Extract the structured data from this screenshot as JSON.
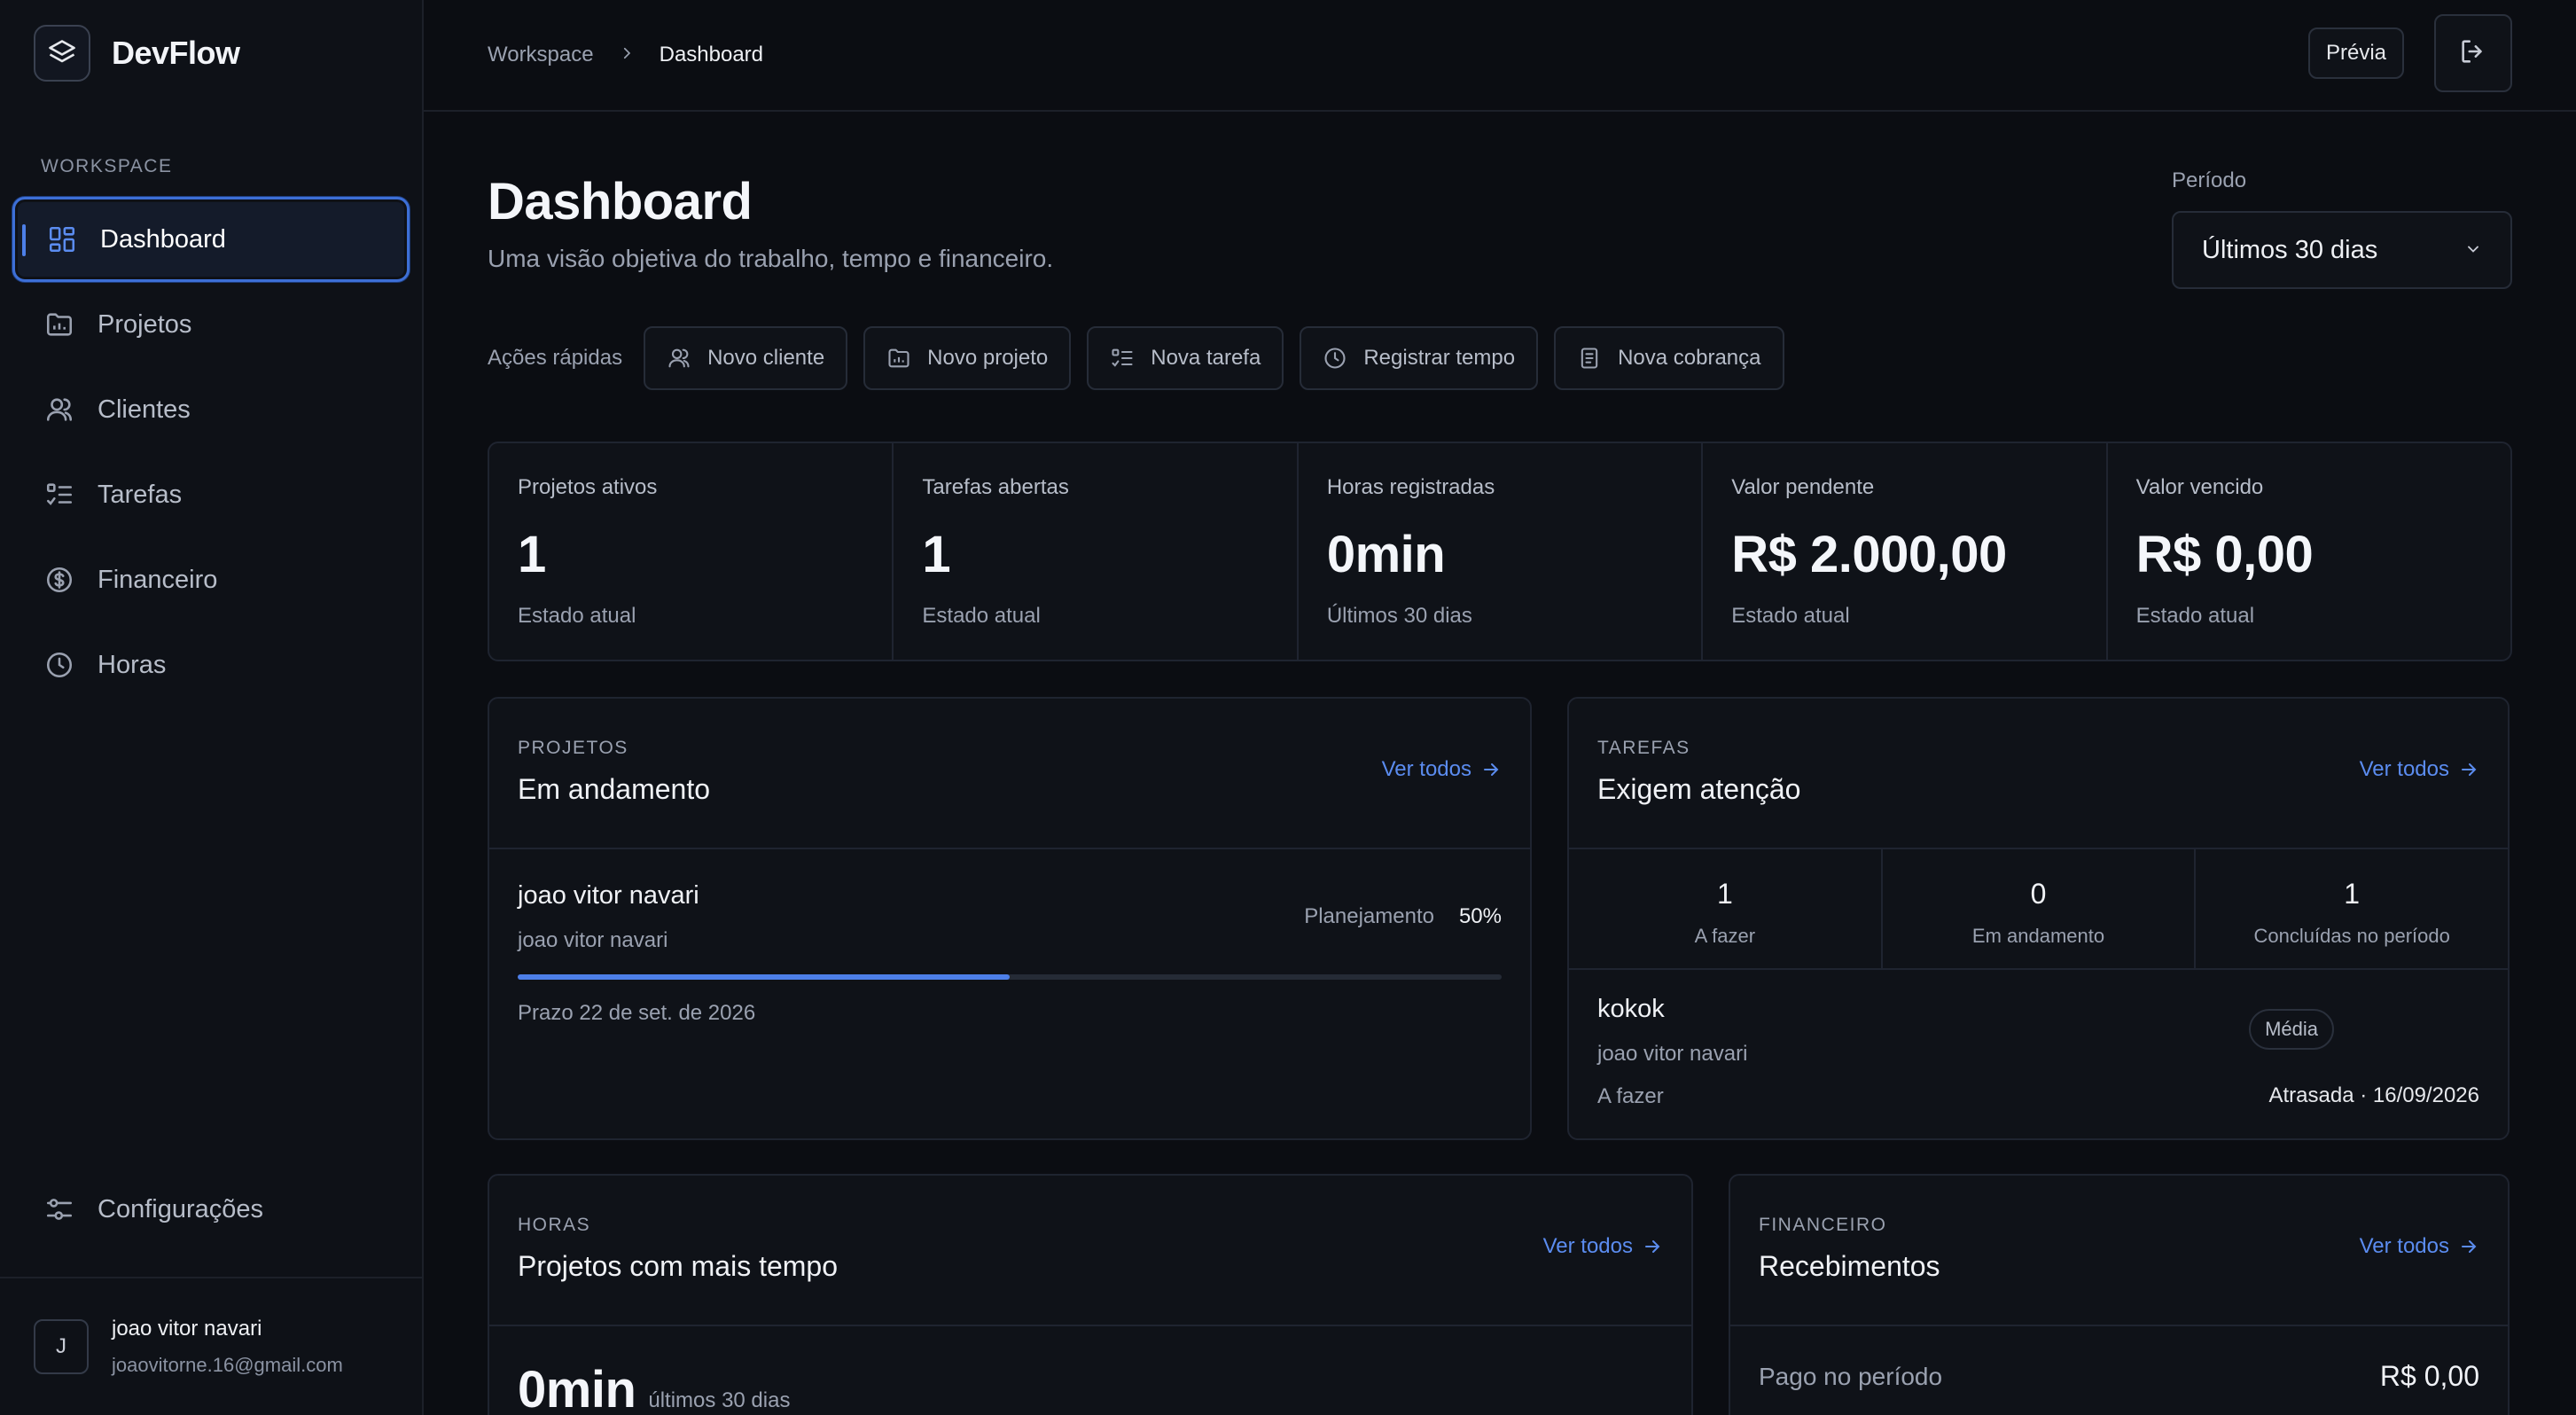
{
  "brand": {
    "name": "DevFlow"
  },
  "sidebar": {
    "section_label": "WORKSPACE",
    "items": [
      {
        "label": "Dashboard",
        "icon": "grid-icon",
        "active": true
      },
      {
        "label": "Projetos",
        "icon": "folder-icon"
      },
      {
        "label": "Clientes",
        "icon": "users-icon"
      },
      {
        "label": "Tarefas",
        "icon": "list-check-icon"
      },
      {
        "label": "Financeiro",
        "icon": "dollar-circle-icon"
      },
      {
        "label": "Horas",
        "icon": "clock-icon"
      }
    ],
    "settings_label": "Configurações",
    "user": {
      "initial": "J",
      "name": "joao vitor navari",
      "email": "joaovitorne.16@gmail.com"
    }
  },
  "topbar": {
    "breadcrumb": [
      "Workspace",
      "Dashboard"
    ],
    "preview_label": "Prévia"
  },
  "header": {
    "title": "Dashboard",
    "subtitle": "Uma visão objetiva do trabalho, tempo e financeiro.",
    "period_label": "Período",
    "period_value": "Últimos 30 dias"
  },
  "quick_actions": {
    "label": "Ações rápidas",
    "items": [
      "Novo cliente",
      "Novo projeto",
      "Nova tarefa",
      "Registrar tempo",
      "Nova cobrança"
    ]
  },
  "stats": [
    {
      "label": "Projetos ativos",
      "value": "1",
      "note": "Estado atual"
    },
    {
      "label": "Tarefas abertas",
      "value": "1",
      "note": "Estado atual"
    },
    {
      "label": "Horas registradas",
      "value": "0min",
      "note": "Últimos 30 dias"
    },
    {
      "label": "Valor pendente",
      "value": "R$ 2.000,00",
      "note": "Estado atual"
    },
    {
      "label": "Valor vencido",
      "value": "R$ 0,00",
      "note": "Estado atual"
    }
  ],
  "ver_todos": "Ver todos",
  "projects_card": {
    "kicker": "PROJETOS",
    "title": "Em andamento",
    "project": {
      "name": "joao vitor navari",
      "client": "joao vitor navari",
      "status": "Planejamento",
      "progress_label": "50%",
      "progress": 0.5,
      "deadline": "Prazo 22 de set. de 2026"
    }
  },
  "tasks_card": {
    "kicker": "TAREFAS",
    "title": "Exigem atenção",
    "counts": [
      {
        "value": "1",
        "label": "A fazer"
      },
      {
        "value": "0",
        "label": "Em andamento"
      },
      {
        "value": "1",
        "label": "Concluídas no período"
      }
    ],
    "task": {
      "title": "kokok",
      "client": "joao vitor navari",
      "status": "A fazer",
      "priority": "Média",
      "due": "Atrasada · 16/09/2026"
    }
  },
  "hours_card": {
    "kicker": "HORAS",
    "title": "Projetos com mais tempo",
    "value": "0min",
    "note": "últimos 30 dias"
  },
  "finance_card": {
    "kicker": "FINANCEIRO",
    "title": "Recebimentos",
    "paid_label": "Pago no período",
    "paid_value": "R$ 0,00"
  },
  "colors": {
    "accent": "#4d7fe8",
    "link": "#5b8cf0",
    "background": "#0b0d12",
    "panel": "#0f1218"
  }
}
